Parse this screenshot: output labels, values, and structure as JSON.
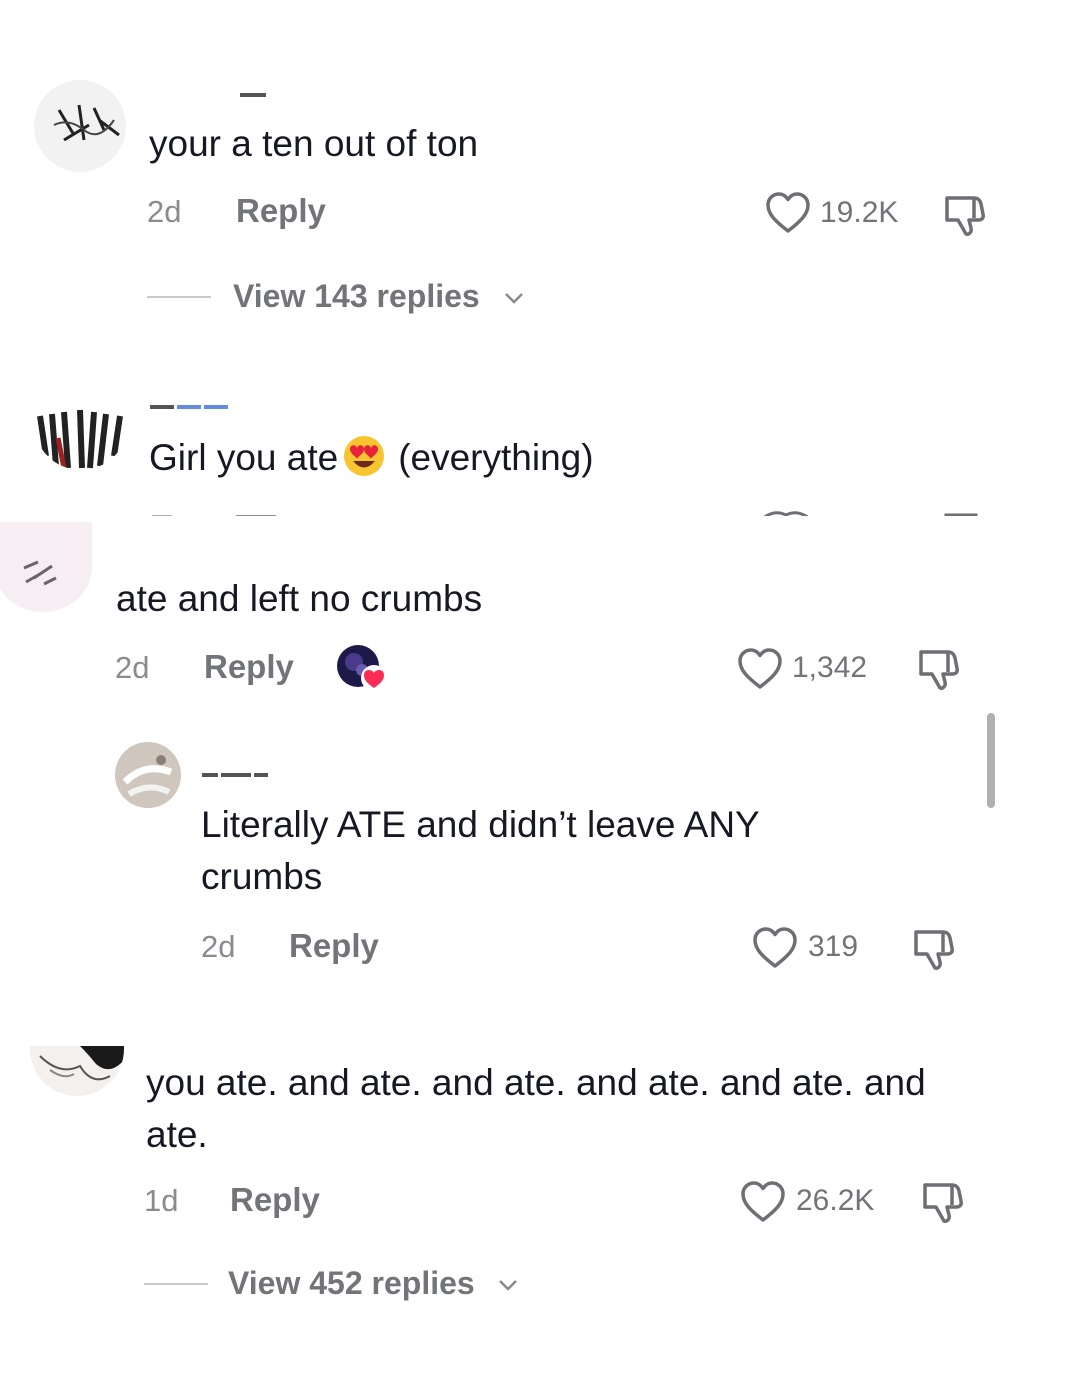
{
  "comments": [
    {
      "text": "your a ten out of ton",
      "age": "2d",
      "reply_label": "Reply",
      "likes": "19.2K",
      "view_replies": "View 143 replies"
    },
    {
      "text_before": "Girl you ate",
      "emoji": "heart-eyes-emoji",
      "text_after": "(everything)"
    },
    {
      "text": "ate and left no crumbs",
      "age": "2d",
      "reply_label": "Reply",
      "likes": "1,342",
      "liked_by_creator_icon": "creator-avatar-heart-icon",
      "replies": [
        {
          "text": "Literally ATE and didn’t leave ANY crumbs",
          "age": "2d",
          "reply_label": "Reply",
          "likes": "319"
        }
      ]
    },
    {
      "text": "you ate. and ate. and ate. and ate. and ate. and ate.",
      "age": "1d",
      "reply_label": "Reply",
      "likes": "26.2K",
      "view_replies": "View 452 replies"
    }
  ],
  "icons": {
    "like": "heart-outline-icon",
    "dislike": "thumbs-down-icon",
    "expand": "chevron-down-icon"
  },
  "colors": {
    "text": "#161823",
    "meta": "#8a8b91",
    "secondary": "#737479",
    "creator_heart": "#fe2c55"
  }
}
